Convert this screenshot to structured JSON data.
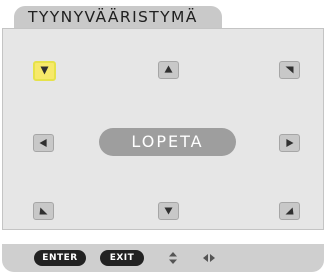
{
  "window": {
    "title": "TYYNYVÄÄRISTYMÄ"
  },
  "grid": {
    "buttons": [
      {
        "name": "top-left-corner-button",
        "direction": "down-right",
        "selected": true
      },
      {
        "name": "top-center-button",
        "direction": "up",
        "selected": false
      },
      {
        "name": "top-right-corner-button",
        "direction": "down-left",
        "selected": false
      },
      {
        "name": "middle-left-button",
        "direction": "left",
        "selected": false
      },
      {
        "name": "middle-right-button",
        "direction": "right",
        "selected": false
      },
      {
        "name": "bottom-left-corner-button",
        "direction": "up-right",
        "selected": false
      },
      {
        "name": "bottom-center-button",
        "direction": "down",
        "selected": false
      },
      {
        "name": "bottom-right-corner-button",
        "direction": "up-left",
        "selected": false
      }
    ],
    "exit_label": "LOPETA"
  },
  "footer": {
    "enter_label": "ENTER",
    "exit_label": "EXIT",
    "icons": [
      "up-down-icon",
      "left-right-icon"
    ]
  },
  "colors": {
    "panel": "#e6e6e6",
    "button": "#c8c8c8",
    "selected": "#f7e96a",
    "pill": "#9e9e9e",
    "footer": "#cfcfcf"
  }
}
